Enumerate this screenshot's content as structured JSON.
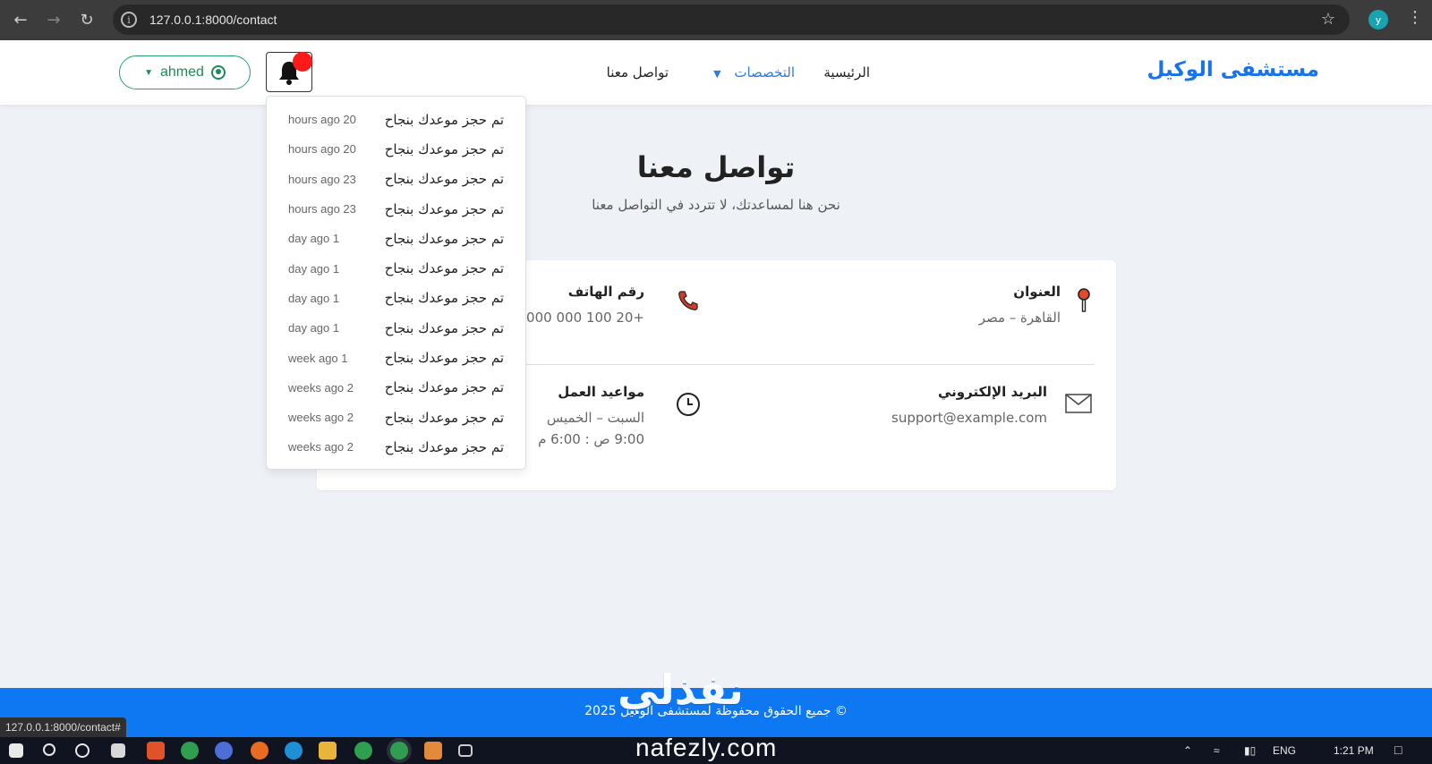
{
  "browser": {
    "url": "127.0.0.1:8000/contact",
    "profile_initial": "y",
    "status_url": "127.0.0.1:8000/contact#"
  },
  "navbar": {
    "brand": "مستشفى الوكيل",
    "links": {
      "home": "الرئيسية",
      "specialties": "التخصصات",
      "contact": "تواصل معنا"
    },
    "user": "ahmed"
  },
  "notifications": [
    {
      "message": "تم حجز موعدك بنجاح",
      "time": "hours ago 20"
    },
    {
      "message": "تم حجز موعدك بنجاح",
      "time": "hours ago 20"
    },
    {
      "message": "تم حجز موعدك بنجاح",
      "time": "hours ago 23"
    },
    {
      "message": "تم حجز موعدك بنجاح",
      "time": "hours ago 23"
    },
    {
      "message": "تم حجز موعدك بنجاح",
      "time": "day ago 1"
    },
    {
      "message": "تم حجز موعدك بنجاح",
      "time": "day ago 1"
    },
    {
      "message": "تم حجز موعدك بنجاح",
      "time": "day ago 1"
    },
    {
      "message": "تم حجز موعدك بنجاح",
      "time": "day ago 1"
    },
    {
      "message": "تم حجز موعدك بنجاح",
      "time": "week ago 1"
    },
    {
      "message": "تم حجز موعدك بنجاح",
      "time": "weeks ago 2"
    },
    {
      "message": "تم حجز موعدك بنجاح",
      "time": "weeks ago 2"
    },
    {
      "message": "تم حجز موعدك بنجاح",
      "time": "weeks ago 2"
    }
  ],
  "page": {
    "title": "تواصل معنا",
    "subtitle": "نحن هنا لمساعدتك، لا تتردد في التواصل معنا"
  },
  "contact": {
    "address_label": "العنوان",
    "address_value": "القاهرة – مصر",
    "phone_label": "رقم الهاتف",
    "phone_value": "+20 100 000 0000",
    "email_label": "البريد الإلكتروني",
    "email_value": "support@example.com",
    "hours_label": "مواعيد العمل",
    "hours_days": "السبت – الخميس",
    "hours_time": "9:00 ص : 6:00 م"
  },
  "footer": {
    "text": "© جميع الحقوق محفوظة لمستشفى الوكيل 2025"
  },
  "watermark": {
    "arabic": "نفذلي",
    "latin": "nafezly.com"
  },
  "taskbar": {
    "lang": "ENG",
    "time": "1:21 PM"
  },
  "colors": {
    "brand": "#1a73e8",
    "footer": "#0d78f2",
    "badge": "#ff1a1a",
    "user_outline": "#28a06a"
  }
}
